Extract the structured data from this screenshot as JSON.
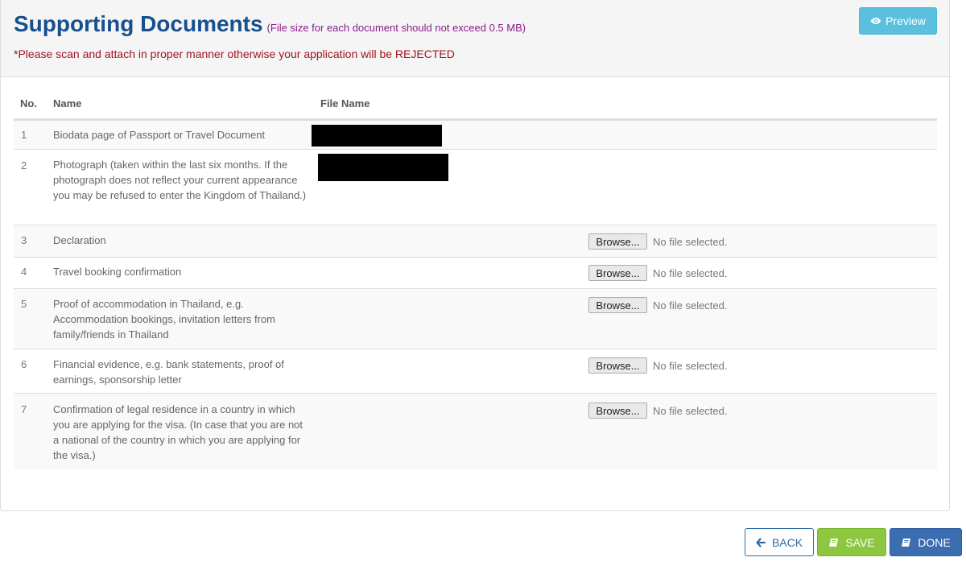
{
  "header": {
    "title": "Supporting Documents",
    "size_note": "(File size for each document should not exceed 0.5 MB)",
    "warning": "*Please scan and attach in proper manner otherwise your application will be REJECTED",
    "preview_label": "Preview",
    "preview_icon": "eye-icon"
  },
  "table": {
    "columns": [
      "No.",
      "Name",
      "File Name"
    ],
    "rows": [
      {
        "no": "1",
        "name": "Biodata page of Passport or Travel Document",
        "file": "redacted"
      },
      {
        "no": "2",
        "name": "Photograph (taken within the last six months. If the photograph does not reflect your current appearance you may be refused to enter the Kingdom of Thailand.)",
        "file": "redacted"
      },
      {
        "no": "3",
        "name": "Declaration",
        "browse_label": "Browse...",
        "file_status": "No file selected."
      },
      {
        "no": "4",
        "name": "Travel booking confirmation",
        "browse_label": "Browse...",
        "file_status": "No file selected."
      },
      {
        "no": "5",
        "name": "Proof of accommodation in Thailand, e.g. Accommodation bookings, invitation letters from family/friends in Thailand",
        "browse_label": "Browse...",
        "file_status": "No file selected."
      },
      {
        "no": "6",
        "name": "Financial evidence, e.g. bank statements, proof of earnings, sponsorship letter",
        "browse_label": "Browse...",
        "file_status": "No file selected."
      },
      {
        "no": "7",
        "name": "Confirmation of legal residence in a country in which you are applying for the visa. (In case that you are not a national of the country in which you are applying for the visa.)",
        "browse_label": "Browse...",
        "file_status": "No file selected."
      }
    ]
  },
  "footer": {
    "back_label": "BACK",
    "save_label": "SAVE",
    "done_label": "DONE",
    "back_icon": "arrow-left-icon",
    "save_icon": "book-icon",
    "done_icon": "book-icon"
  },
  "colors": {
    "title": "#17508f",
    "warning": "#a0141e",
    "size_note": "#8b1c8b",
    "preview": "#5bc0de",
    "save": "#8dc63f",
    "done": "#3c6db0"
  }
}
